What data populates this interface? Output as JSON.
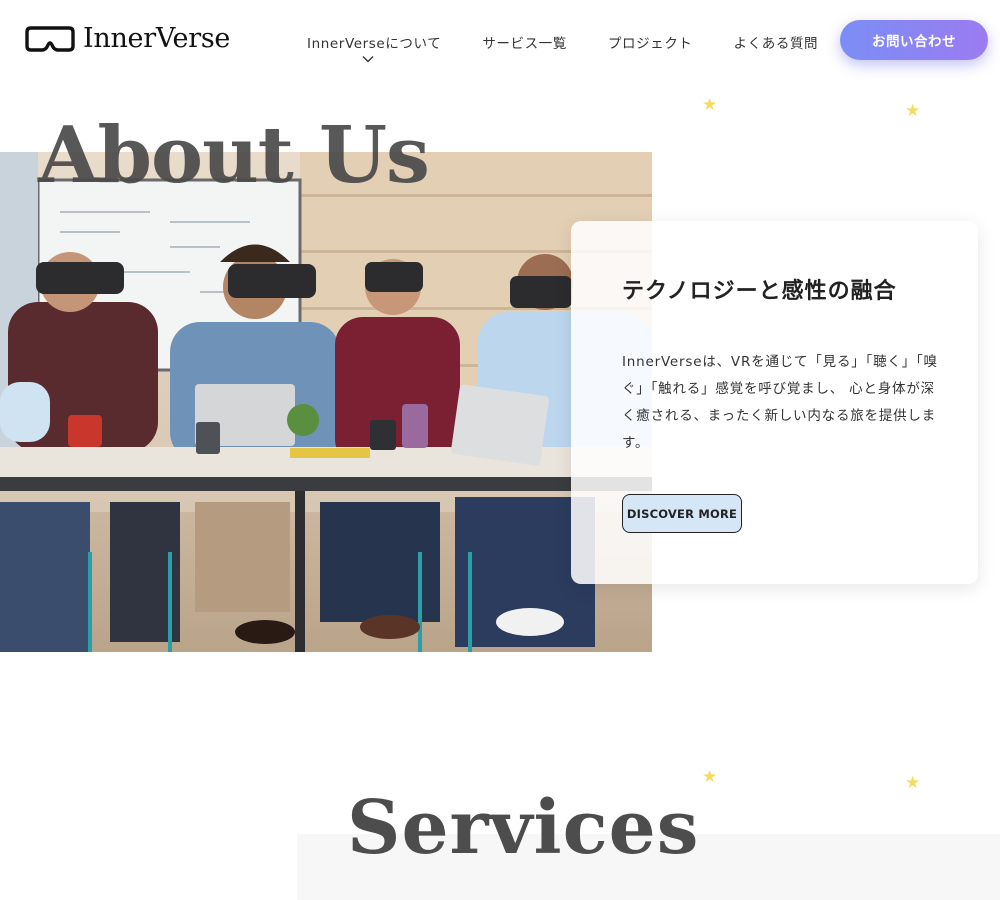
{
  "brand": {
    "name": "InnerVerse"
  },
  "nav": {
    "items": [
      "InnerVerseについて",
      "サービス一覧",
      "プロジェクト",
      "よくある質問"
    ],
    "contact_label": "お問い合わせ"
  },
  "about": {
    "title": "About Us",
    "card": {
      "heading": "テクノロジーと感性の融合",
      "body": "InnerVerseは、VRを通じて「見る」「聴く」「嗅ぐ」「触れる」感覚を呼び覚まし、 心と身体が深く癒される、まったく新しい内なる旅を提供します。",
      "button_label": "DISCOVER MORE"
    }
  },
  "services": {
    "title": "Services"
  },
  "icons": {
    "logo": "vr-headset-icon",
    "dropdown": "chevron-down-icon",
    "decoration": "star-icon"
  },
  "colors": {
    "accent_gradient_start": "#7b8ef5",
    "accent_gradient_end": "#9b7bf1",
    "star": "#f3dc60",
    "discover_button_bg": "#d5e7f7"
  }
}
